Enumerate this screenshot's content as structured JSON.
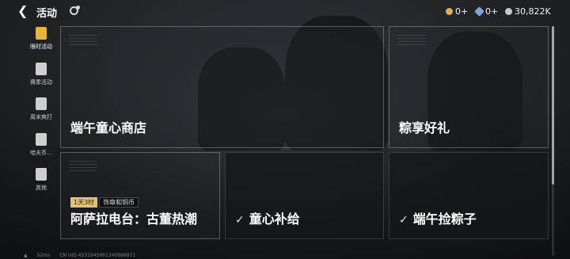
{
  "header": {
    "title": "活动",
    "currencies": [
      {
        "icon": "coin-icon",
        "value": "0+",
        "color": "#d8b25a"
      },
      {
        "icon": "crystal-icon",
        "value": "0+",
        "color": "#7fa3d6"
      },
      {
        "icon": "silver-coin-icon",
        "value": "30,822K",
        "color": "#c9c9c9"
      }
    ]
  },
  "sidebar": {
    "items": [
      {
        "label": "限时活动",
        "active": true
      },
      {
        "label": "赛季活动",
        "active": false
      },
      {
        "label": "周末爽打",
        "active": false
      },
      {
        "label": "哈夫币...",
        "active": false
      },
      {
        "label": "其他",
        "active": false
      }
    ]
  },
  "cards": {
    "shop": {
      "name": "端午童心商店"
    },
    "gift": {
      "name": "粽享好礼"
    },
    "radio": {
      "name": "阿萨拉电台：古董热潮",
      "time_tag": "1天3时",
      "desc_tag": "饰章和铜币"
    },
    "supply": {
      "name": "童心补给",
      "completed": true
    },
    "zongzi": {
      "name": "端午捡粽子",
      "completed": true
    }
  },
  "footer": {
    "ping": "52ms",
    "uid": "CN UID:4531945961340686871"
  }
}
